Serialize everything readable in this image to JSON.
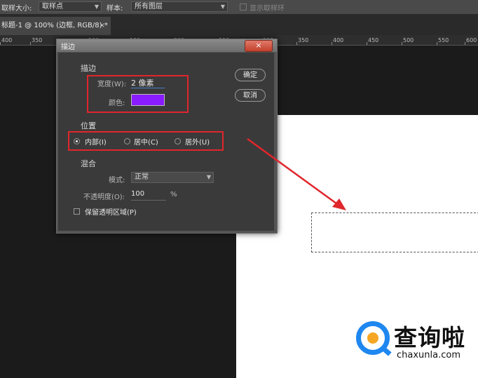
{
  "options_bar": {
    "sample_size_label": "取样大小:",
    "sample_size_value": "取样点",
    "sample_label": "样本:",
    "sample_value": "所有图层",
    "show_ring_label": "显示取样环"
  },
  "document_tab": {
    "title": "标题-1 @ 100% (边框, RGB/8) *",
    "close": "×"
  },
  "ruler": {
    "ticks": [
      "400",
      "350",
      "100",
      "150",
      "200",
      "250",
      "300",
      "350",
      "400",
      "450",
      "500",
      "550",
      "600"
    ]
  },
  "dialog": {
    "title": "描边",
    "close": "×",
    "stroke_section": "描边",
    "width_label": "宽度(W):",
    "width_value": "2 像素",
    "color_label": "颜色:",
    "color_value": "#8a1aff",
    "position_section": "位置",
    "positions": [
      "内部(I)",
      "居中(C)",
      "居外(U)"
    ],
    "selected_position": "内部(I)",
    "blend_section": "混合",
    "mode_label": "模式:",
    "mode_value": "正常",
    "opacity_label": "不透明度(O):",
    "opacity_value": "100",
    "opacity_unit": "%",
    "preserve_label": "保留透明区域(P)",
    "ok_label": "确定",
    "cancel_label": "取消"
  },
  "watermark": {
    "brand": "查询啦",
    "url": "chaxunla.com"
  },
  "colors": {
    "annotation_red": "#e0262c",
    "stroke_color": "#8a1aff"
  }
}
